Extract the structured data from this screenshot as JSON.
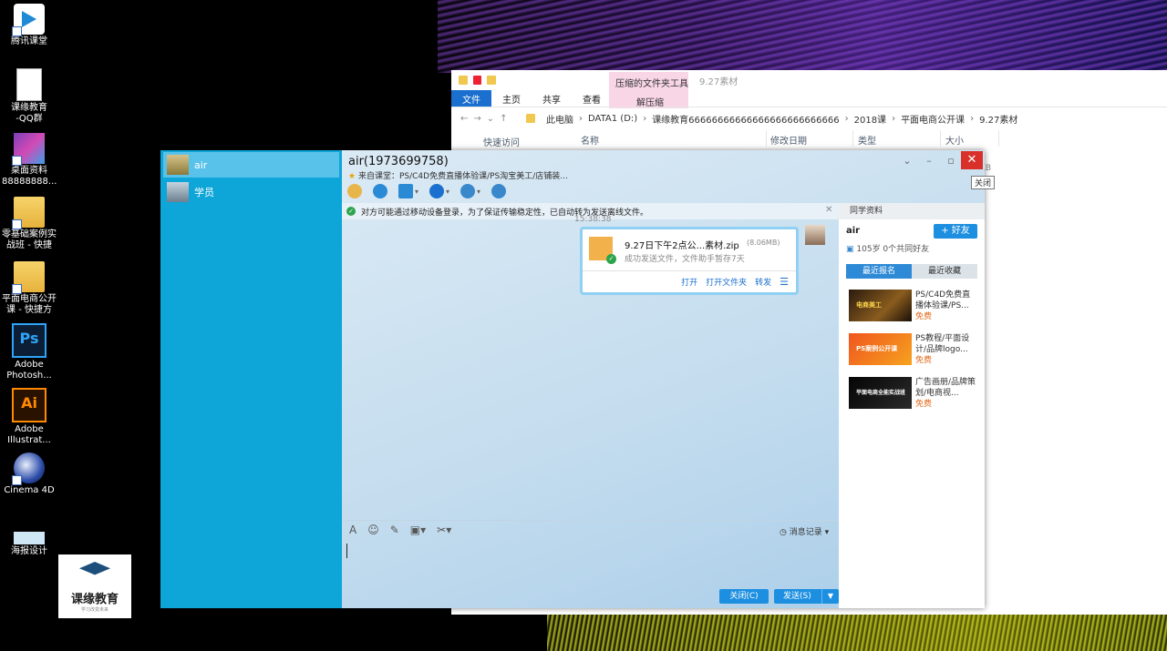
{
  "desktop": {
    "icons": [
      {
        "label": "腾讯课堂",
        "icon": "tencent-classroom-icon"
      },
      {
        "label": "课缘教育\n-QQ群",
        "icon": "document-icon"
      },
      {
        "label": "桌面资料\n88888888...",
        "icon": "package-icon"
      },
      {
        "label": "零基础案例实\n战班 - 快捷",
        "icon": "folder-icon"
      },
      {
        "label": "平面电商公开\n课 - 快捷方",
        "icon": "folder-icon"
      },
      {
        "label": "Adobe\nPhotosh...",
        "icon": "photoshop-icon"
      },
      {
        "label": "Adobe\nIllustrat...",
        "icon": "illustrator-icon"
      },
      {
        "label": "Cinema 4D",
        "icon": "cinema4d-icon"
      },
      {
        "label": "海报设计",
        "icon": "image-icon"
      }
    ],
    "ps_glyph": "Ps",
    "ai_glyph": "Ai",
    "logo_text": "课缘教育",
    "logo_sub": "学习改变未来"
  },
  "explorer": {
    "context_tab": "压缩的文件夹工具",
    "context_sub": "解压缩",
    "window_title": "9.27素材",
    "tabs": [
      "文件",
      "主页",
      "共享",
      "查看"
    ],
    "breadcrumb": [
      "此电脑",
      "DATA1 (D:)",
      "课缘教育66666666666666666666666666",
      "2018课",
      "平面电商公开课",
      "9.27素材"
    ],
    "columns": [
      "名称",
      "修改日期",
      "类型",
      "大小"
    ],
    "quick_access": "快速访问",
    "size_partial": "KB"
  },
  "qq": {
    "contacts": [
      {
        "name": "air",
        "selected": true
      },
      {
        "name": "学员",
        "selected": false
      }
    ],
    "chat_title": "air(1973699758)",
    "from_class": "来自课堂：PS/C4D免费直播体验课/PS淘宝美工/店铺装...",
    "close_tooltip": "关闭",
    "notice": "对方可能通过移动设备登录，为了保证传输稳定性，已自动转为发送离线文件。",
    "timestamp": "15:38:38",
    "file_message": {
      "name": "9.27日下午2点公...素材.zip",
      "size": "(8.06MB)",
      "status": "成功发送文件，文件助手暂存7天",
      "actions": [
        "打开",
        "打开文件夹",
        "转发"
      ]
    },
    "history_label": "消息记录",
    "close_button": "关闭(C)",
    "send_button": "发送(S)",
    "side": {
      "header": "同学资料",
      "name": "air",
      "add_friend": "好友",
      "info": "105岁  0个共同好友",
      "tabs": [
        "最近报名",
        "最近收藏"
      ],
      "courses": [
        {
          "title": "PS/C4D免费直播体验课/PS...",
          "price": "免费",
          "thumb_text": "电商美工"
        },
        {
          "title": "PS教程/平面设计/品牌logo...",
          "price": "免费",
          "thumb_text": "PS案例公开课"
        },
        {
          "title": "广告画册/品牌策划/电商视...",
          "price": "免费",
          "thumb_text": "平面电商全能实战班"
        }
      ]
    }
  },
  "colors": {
    "qq_sidebar": "#0ea5d8",
    "accent_blue": "#1d8fe0",
    "close_red": "#d9312a",
    "free_orange": "#e36a1a"
  }
}
